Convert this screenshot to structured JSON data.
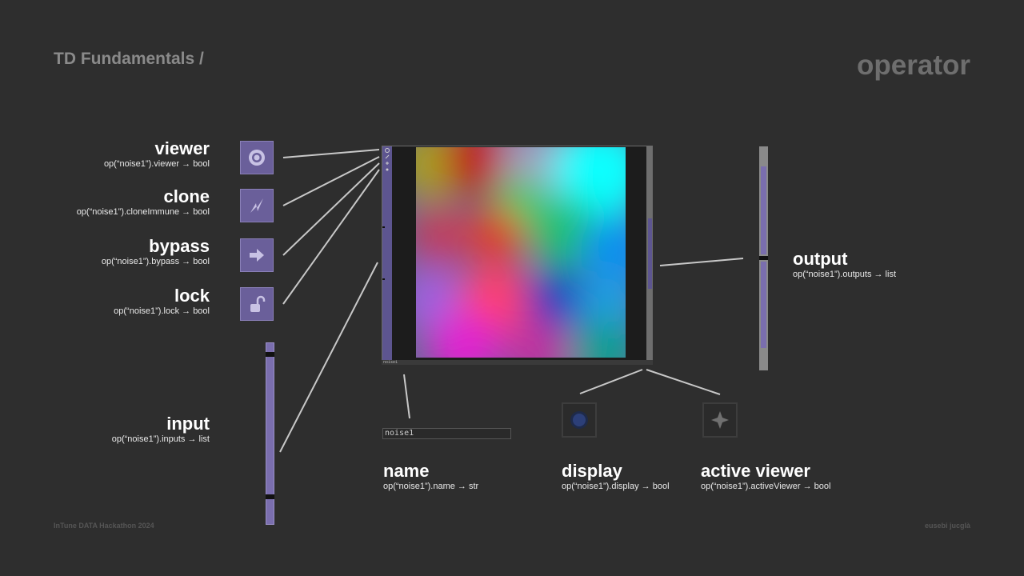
{
  "header": {
    "breadcrumb": "TD Fundamentals /",
    "title": "operator"
  },
  "footer": {
    "left": "InTune DATA Hackathon 2024",
    "right": "eusebi jucglà"
  },
  "flags": [
    {
      "title": "viewer",
      "code": "op(“noise1”).viewer → bool",
      "icon": "viewer-icon"
    },
    {
      "title": "clone",
      "code": "op(“noise1”).cloneImmune → bool",
      "icon": "clone-icon"
    },
    {
      "title": "bypass",
      "code": "op(“noise1”).bypass → bool",
      "icon": "bypass-icon"
    },
    {
      "title": "lock",
      "code": "op(“noise1”).lock  → bool",
      "icon": "lock-icon"
    }
  ],
  "input": {
    "title": "input",
    "code": "op(“noise1”).inputs → list"
  },
  "output": {
    "title": "output",
    "code": "op(“noise1”).outputs → list"
  },
  "name": {
    "title": "name",
    "code": "op(“noise1”).name → str",
    "field_value": "noise1"
  },
  "display": {
    "title": "display",
    "code": "op(“noise1”).display → bool",
    "icon": "display-icon"
  },
  "active_viewer": {
    "title": "active viewer",
    "code": "op(“noise1”).activeViewer → bool",
    "icon": "active-viewer-icon"
  },
  "node": {
    "footer_label": "noise1"
  },
  "colors": {
    "background": "#2e2e2e",
    "flag": "#6a5f9a",
    "connector": "#c8c8c8"
  }
}
